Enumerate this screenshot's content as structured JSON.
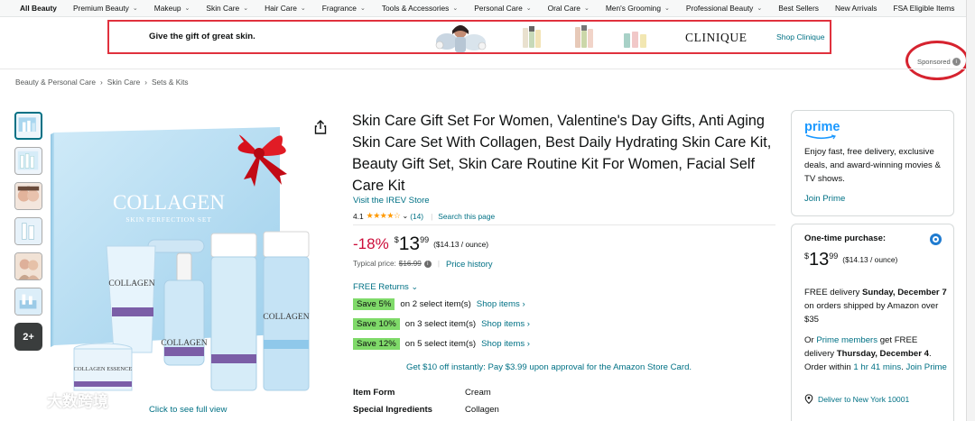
{
  "nav": {
    "items": [
      {
        "label": "All Beauty",
        "dropdown": false,
        "bold": true
      },
      {
        "label": "Premium Beauty",
        "dropdown": true
      },
      {
        "label": "Makeup",
        "dropdown": true
      },
      {
        "label": "Skin Care",
        "dropdown": true
      },
      {
        "label": "Hair Care",
        "dropdown": true
      },
      {
        "label": "Fragrance",
        "dropdown": true
      },
      {
        "label": "Tools & Accessories",
        "dropdown": true
      },
      {
        "label": "Personal Care",
        "dropdown": true
      },
      {
        "label": "Oral Care",
        "dropdown": true
      },
      {
        "label": "Men's Grooming",
        "dropdown": true
      },
      {
        "label": "Professional Beauty",
        "dropdown": true
      },
      {
        "label": "Best Sellers",
        "dropdown": false
      },
      {
        "label": "New Arrivals",
        "dropdown": false
      },
      {
        "label": "FSA Eligible Items",
        "dropdown": false
      }
    ]
  },
  "banner": {
    "tagline": "Give the gift of great skin.",
    "brand": "CLINIQUE",
    "cta": "Shop Clinique"
  },
  "sponsored": {
    "label": "Sponsored",
    "info_icon": "info-icon"
  },
  "breadcrumb": [
    "Beauty & Personal Care",
    "Skin Care",
    "Sets & Kits"
  ],
  "gallery": {
    "more_label": "2+",
    "see_full": "Click to see full view",
    "box_brand": "COLLAGEN",
    "box_sub": "SKIN PERFECTION SET",
    "tube_label": "COLLAGEN",
    "dropper_label": "COLLAGEN",
    "toner_label": "COLLAGEN",
    "jar_label": "COLLAGEN ESSENCE"
  },
  "product": {
    "title": "Skin Care Gift Set For Women, Valentine's Day Gifts, Anti Aging Skin Care Set With Collagen, Best Daily Hydrating Skin Care Kit, Beauty Gift Set, Skin Care Routine Kit For Women, Facial Self Care Kit",
    "store": "Visit the IREV Store",
    "rating": "4.1",
    "rating_value": 4.1,
    "stars": "★★★★☆",
    "rating_count": "(14)",
    "search_page": "Search this page",
    "discount": "-18%",
    "currency": "$",
    "price_whole": "13",
    "price_frac": "99",
    "unit_price": "($14.13 / ounce)",
    "typical_label": "Typical price:",
    "typical_price": "$16.99",
    "price_history": "Price history",
    "returns": "FREE Returns",
    "promos": [
      {
        "badge": "Save 5%",
        "text": "on 2 select item(s)",
        "link": "Shop items ›"
      },
      {
        "badge": "Save 10%",
        "text": "on 3 select item(s)",
        "link": "Shop items ›"
      },
      {
        "badge": "Save 12%",
        "text": "on 5 select item(s)",
        "link": "Shop items ›"
      }
    ],
    "card_offer": "Get $10 off instantly: Pay $3.99 upon approval for the Amazon Store Card.",
    "specs": [
      {
        "key": "Item Form",
        "value": "Cream"
      },
      {
        "key": "Special Ingredients",
        "value": "Collagen"
      }
    ]
  },
  "prime": {
    "logo": "prime",
    "text": "Enjoy fast, free delivery, exclusive deals, and award-winning movies & TV shows.",
    "join": "Join Prime"
  },
  "buybox": {
    "one_time": "One-time purchase:",
    "currency": "$",
    "price_whole": "13",
    "price_frac": "99",
    "unit_price": "($14.13 / ounce)",
    "delivery_pre": "FREE delivery ",
    "delivery_date": "Sunday, December 7",
    "delivery_post": " on orders shipped by Amazon over $35",
    "or_text": "Or ",
    "prime_members": "Prime members",
    "get_free": " get FREE delivery ",
    "fast_date": "Thursday, December 4",
    "order_within": ". Order within ",
    "countdown": "1 hr 41 mins",
    "join_prime": "Join Prime",
    "deliver_to": "Deliver to New York 10001"
  },
  "watermark": {
    "text": "大数跨境"
  },
  "colors": {
    "link": "#007185",
    "deal": "#cc0c39",
    "badge": "#7fda69",
    "highlight": "#e0313d",
    "prime": "#1a98ff"
  }
}
